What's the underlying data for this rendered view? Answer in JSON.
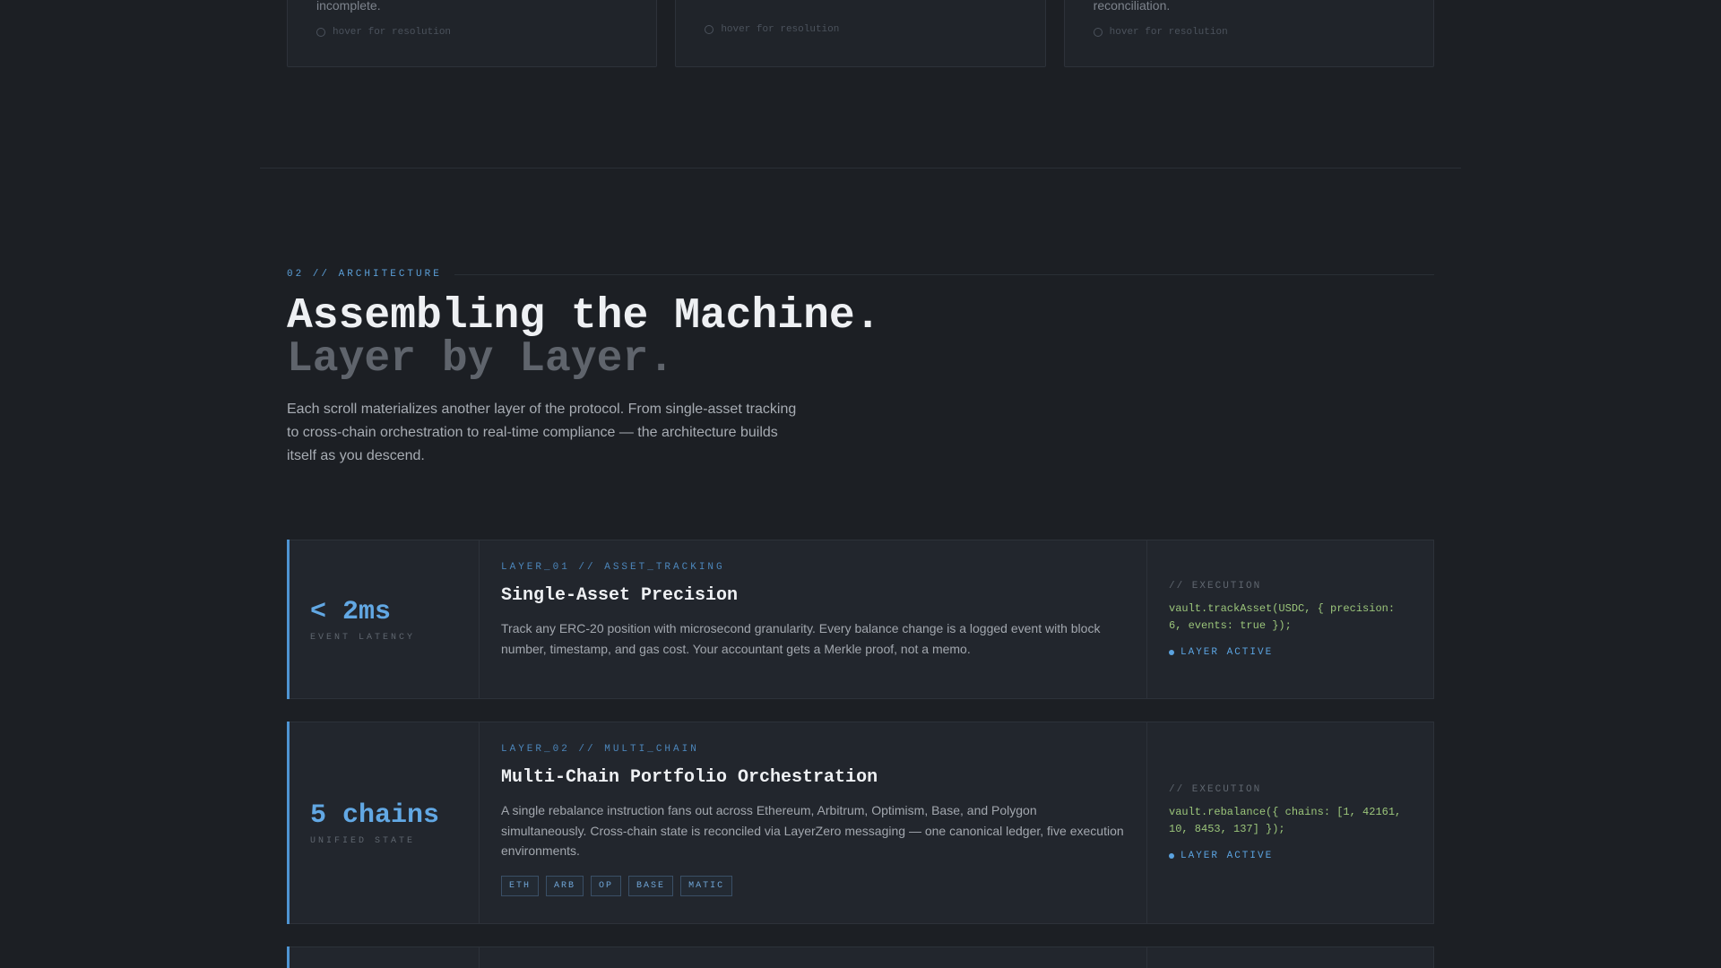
{
  "top_cards": [
    {
      "text": "incomplete.",
      "hint": "hover for resolution"
    },
    {
      "text": "",
      "hint": "hover for resolution"
    },
    {
      "text": "reconciliation.",
      "hint": "hover for resolution"
    }
  ],
  "section": {
    "eyebrow": "02 // ARCHITECTURE",
    "title_line1": "Assembling the Machine.",
    "title_line2": "Layer by Layer.",
    "intro": "Each scroll materializes another layer of the protocol. From single-asset tracking to cross-chain orchestration to real-time compliance — the architecture builds itself as you descend."
  },
  "layers": [
    {
      "stat_value": "< 2ms",
      "stat_label": "EVENT LATENCY",
      "tag": "LAYER_01 // ASSET_TRACKING",
      "title": "Single-Asset Precision",
      "description": "Track any ERC-20 position with microsecond granularity. Every balance change is a logged event with block number, timestamp, and gas cost. Your accountant gets a Merkle proof, not a memo.",
      "exec_label": "// EXECUTION",
      "exec_code": "vault.trackAsset(USDC, { precision: 6, events: true });",
      "status": "LAYER ACTIVE"
    },
    {
      "stat_value": "5 chains",
      "stat_label": "UNIFIED STATE",
      "tag": "LAYER_02 // MULTI_CHAIN",
      "title": "Multi-Chain Portfolio Orchestration",
      "description": "A single rebalance instruction fans out across Ethereum, Arbitrum, Optimism, Base, and Polygon simultaneously. Cross-chain state is reconciled via LayerZero messaging — one canonical ledger, five execution environments.",
      "chips": [
        "ETH",
        "ARB",
        "OP",
        "BASE",
        "MATIC"
      ],
      "exec_label": "// EXECUTION",
      "exec_code": "vault.rebalance({ chains: [1, 42161, 10, 8453, 137] });",
      "status": "LAYER ACTIVE"
    }
  ]
}
